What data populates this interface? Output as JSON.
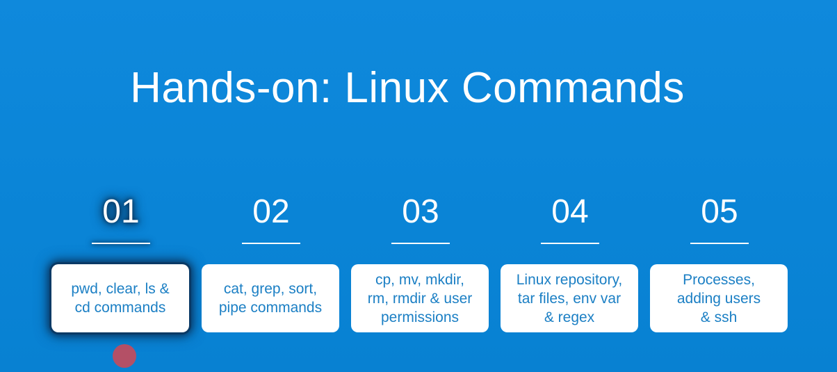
{
  "slide": {
    "title": "Hands-on: Linux Commands",
    "accent_color": "#0b86d8",
    "card_text_color": "#1b7fc4",
    "active_step_index": 0,
    "steps": [
      {
        "number": "01",
        "text": "pwd, clear, ls &\ncd commands"
      },
      {
        "number": "02",
        "text": "cat, grep, sort,\npipe commands"
      },
      {
        "number": "03",
        "text": "cp, mv, mkdir,\nrm, rmdir & user\npermissions"
      },
      {
        "number": "04",
        "text": "Linux repository,\ntar files, env var\n& regex"
      },
      {
        "number": "05",
        "text": "Processes,\nadding users\n& ssh"
      }
    ]
  }
}
